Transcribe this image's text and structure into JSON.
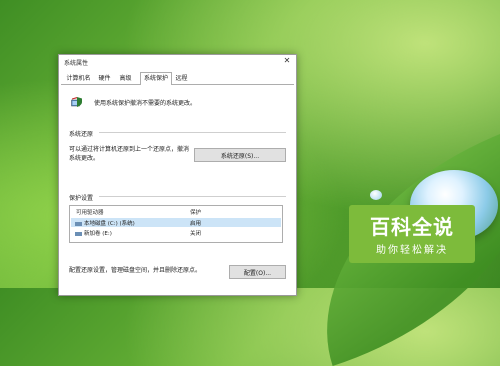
{
  "window": {
    "title": "系统属性",
    "close_glyph": "✕"
  },
  "tabs": [
    {
      "label": "计算机名"
    },
    {
      "label": "硬件"
    },
    {
      "label": "高级"
    },
    {
      "label": "系统保护",
      "active": true
    },
    {
      "label": "远程"
    }
  ],
  "intro": {
    "icon": "system-protection-shield-icon",
    "text": "使用系统保护撤消不需要的系统更改。"
  },
  "restore_section": {
    "title": "系统还原",
    "description_line1": "可以通过将计算机还原到上一个还原点，撤消",
    "description_line2": "系统更改。",
    "button_label": "系统还原(S)..."
  },
  "protection_section": {
    "title": "保护设置",
    "columns": [
      "可用驱动器",
      "保护"
    ],
    "rows": [
      {
        "drive": "本地磁盘 (C:) (系统)",
        "protection": "启用",
        "selected": true
      },
      {
        "drive": "新加卷 (E:)",
        "protection": "关闭",
        "selected": false
      }
    ],
    "config_text": "配置还原设置，管理磁盘空间，并且删除还原点。",
    "config_button": "配置(O)..."
  },
  "watermark": {
    "title": "百科全说",
    "subtitle": "助你轻松解决",
    "color": "#7dbb3b"
  }
}
